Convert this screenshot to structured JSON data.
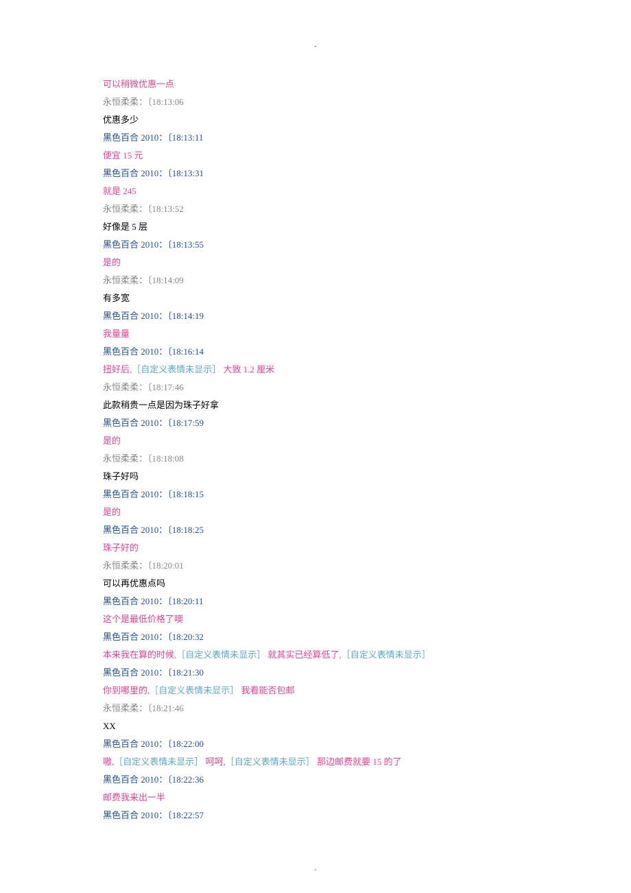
{
  "pageDotTop": ".",
  "pageDotBottom": ".",
  "lines": [
    {
      "parts": [
        {
          "cls": "pink",
          "t": "可以稍微优惠一点"
        }
      ]
    },
    {
      "parts": [
        {
          "cls": "gray",
          "t": "永恒柔柔：〔18:13:06"
        }
      ]
    },
    {
      "parts": [
        {
          "cls": "black",
          "t": "优惠多少"
        }
      ]
    },
    {
      "parts": [
        {
          "cls": "blue",
          "t": "黑色百合 2010：〔18:13:11"
        }
      ]
    },
    {
      "parts": [
        {
          "cls": "pink",
          "t": "便宜 15 元"
        }
      ]
    },
    {
      "parts": [
        {
          "cls": "blue",
          "t": "黑色百合 2010：〔18:13:31"
        }
      ]
    },
    {
      "parts": [
        {
          "cls": "pink",
          "t": "就是 245"
        }
      ]
    },
    {
      "parts": [
        {
          "cls": "gray",
          "t": "永恒柔柔：〔18:13:52"
        }
      ]
    },
    {
      "parts": [
        {
          "cls": "black",
          "t": "好像是 5 层"
        }
      ]
    },
    {
      "parts": [
        {
          "cls": "blue",
          "t": "黑色百合 2010：〔18:13:55"
        }
      ]
    },
    {
      "parts": [
        {
          "cls": "pink",
          "t": "是的"
        }
      ]
    },
    {
      "parts": [
        {
          "cls": "gray",
          "t": "永恒柔柔：〔18:14:09"
        }
      ]
    },
    {
      "parts": [
        {
          "cls": "black",
          "t": "有多宽"
        }
      ]
    },
    {
      "parts": [
        {
          "cls": "blue",
          "t": "黑色百合 2010：〔18:14:19"
        }
      ]
    },
    {
      "parts": [
        {
          "cls": "pink",
          "t": "我量量"
        }
      ]
    },
    {
      "parts": [
        {
          "cls": "blue",
          "t": "黑色百合 2010：〔18:16:14"
        }
      ]
    },
    {
      "parts": [
        {
          "cls": "pink",
          "t": "扭好后,"
        },
        {
          "cls": "cyan",
          "t": "［自定义表情未显示］"
        },
        {
          "cls": "pink",
          "t": " 大致 1.2 厘米"
        }
      ]
    },
    {
      "parts": [
        {
          "cls": "gray",
          "t": "永恒柔柔：〔18:17:46"
        }
      ]
    },
    {
      "parts": [
        {
          "cls": "black",
          "t": "此款稍贵一点是因为珠子好拿"
        }
      ]
    },
    {
      "parts": [
        {
          "cls": "blue",
          "t": "黑色百合 2010：〔18:17:59"
        }
      ]
    },
    {
      "parts": [
        {
          "cls": "pink",
          "t": "是的"
        }
      ]
    },
    {
      "parts": [
        {
          "cls": "gray",
          "t": "永恒柔柔：〔18:18:08"
        }
      ]
    },
    {
      "parts": [
        {
          "cls": "black",
          "t": "珠子好吗"
        }
      ]
    },
    {
      "parts": [
        {
          "cls": "blue",
          "t": "黑色百合 2010：〔18:18:15"
        }
      ]
    },
    {
      "parts": [
        {
          "cls": "pink",
          "t": "是的"
        }
      ]
    },
    {
      "parts": [
        {
          "cls": "blue",
          "t": "黑色百合 2010：〔18:18:25"
        }
      ]
    },
    {
      "parts": [
        {
          "cls": "pink",
          "t": "珠子好的"
        }
      ]
    },
    {
      "parts": [
        {
          "cls": "gray",
          "t": "永恒柔柔：〔18:20:01"
        }
      ]
    },
    {
      "parts": [
        {
          "cls": "black",
          "t": "可以再优惠点吗"
        }
      ]
    },
    {
      "parts": [
        {
          "cls": "blue",
          "t": "黑色百合 2010：〔18:20:11"
        }
      ]
    },
    {
      "parts": [
        {
          "cls": "pink",
          "t": "这个是最低价格了噢"
        }
      ]
    },
    {
      "parts": [
        {
          "cls": "blue",
          "t": "黑色百合 2010：〔18:20:32"
        }
      ]
    },
    {
      "parts": [
        {
          "cls": "pink",
          "t": "本来我在算的时候,"
        },
        {
          "cls": "cyan",
          "t": "［自定义表情未显示］"
        },
        {
          "cls": "pink",
          "t": " 就其实已经算低了,"
        },
        {
          "cls": "cyan",
          "t": "［自定义表情未显示］"
        }
      ]
    },
    {
      "parts": [
        {
          "cls": "blue",
          "t": "黑色百合 2010：〔18:21:30"
        }
      ]
    },
    {
      "parts": [
        {
          "cls": "pink",
          "t": "你到哪里的,"
        },
        {
          "cls": "cyan",
          "t": "［自定义表情未显示］"
        },
        {
          "cls": "pink",
          "t": " 我看能否包邮"
        }
      ]
    },
    {
      "parts": [
        {
          "cls": "gray",
          "t": "永恒柔柔：〔18:21:46"
        }
      ]
    },
    {
      "parts": [
        {
          "cls": "black",
          "t": "XX"
        }
      ]
    },
    {
      "parts": [
        {
          "cls": "blue",
          "t": "黑色百合 2010：〔18:22:00"
        }
      ]
    },
    {
      "parts": [
        {
          "cls": "pink",
          "t": "嗷,"
        },
        {
          "cls": "cyan",
          "t": "［自定义表情未显示］"
        },
        {
          "cls": "pink",
          "t": " 呵呵,"
        },
        {
          "cls": "cyan",
          "t": "［自定义表情未显示］"
        },
        {
          "cls": "pink",
          "t": " 那边邮费就要 15 的了"
        }
      ]
    },
    {
      "parts": [
        {
          "cls": "blue",
          "t": "黑色百合 2010：〔18:22:36"
        }
      ]
    },
    {
      "parts": [
        {
          "cls": "pink",
          "t": "邮费我来出一半"
        }
      ]
    },
    {
      "parts": [
        {
          "cls": "blue",
          "t": "黑色百合 2010：〔18:22:57"
        }
      ]
    }
  ]
}
